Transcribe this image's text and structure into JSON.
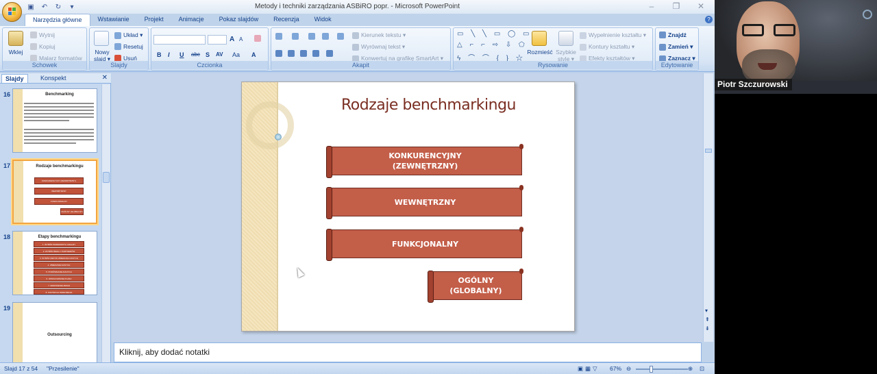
{
  "window": {
    "title": "Metody i techniki zarządzania ASBiRO popr. - Microsoft PowerPoint",
    "controls": [
      "–",
      "❐",
      "✕"
    ]
  },
  "tabs": [
    "Narzędzia główne",
    "Wstawianie",
    "Projekt",
    "Animacje",
    "Pokaz slajdów",
    "Recenzja",
    "Widok"
  ],
  "ribbon": {
    "clipboard": {
      "label": "Schowek",
      "paste": "Wklej",
      "cut": "Wytnij",
      "copy": "Kopiuj",
      "painter": "Malarz formatów"
    },
    "slides": {
      "label": "Slajdy",
      "new_slide_1": "Nowy",
      "new_slide_2": "slajd ▾",
      "layout": "Układ ▾",
      "reset": "Resetuj",
      "delete": "Usuń"
    },
    "font": {
      "label": "Czcionka",
      "bold": "B",
      "italic": "I",
      "underline": "U",
      "strike": "abc",
      "shadow": "S",
      "spacing": "AV",
      "case": "Aa",
      "color": "A",
      "grow": "A",
      "shrink": "A"
    },
    "paragraph": {
      "label": "Akapit",
      "text_direction": "Kierunek tekstu ▾",
      "align_text": "Wyrównaj tekst ▾",
      "smartart": "Konwertuj na grafikę SmartArt ▾"
    },
    "drawing": {
      "label": "Rysowanie",
      "arrange": "Rozmieść",
      "quick_styles_1": "Szybkie",
      "quick_styles_2": "style ▾",
      "fill": "Wypełnienie kształtu ▾",
      "outline": "Kontury kształtu ▾",
      "effects": "Efekty kształtów ▾"
    },
    "editing": {
      "label": "Edytowanie",
      "find": "Znajdź",
      "replace": "Zamień ▾",
      "select": "Zaznacz ▾"
    }
  },
  "left_pane": {
    "tabs": [
      "Slajdy",
      "Konspekt"
    ],
    "thumbnails": [
      {
        "number": "16",
        "title": "Benchmarking"
      },
      {
        "number": "17",
        "title": "Rodzaje benchmarkingu",
        "bars": [
          "KONKURENCYJNY (ZEWNĘTRZNY)",
          "WEWNĘTRZNY",
          "FUNKCJONALNY",
          "OGÓLNY (GLOBALNY)"
        ]
      },
      {
        "number": "18",
        "title": "Etapy benchmarkingu",
        "bars": [
          "1. WYBÓR PRZEDMIOTU ANALIZY",
          "2. WYBÓR BIEGU / PARTNERÓW",
          "3. WYBÓR METOD ZBIERANIA DANYCH",
          "4. ZBIERANIE DANYCH",
          "5. PORÓWNANIE DANYCH",
          "6. OPRACOWANIE PLANU",
          "7. WDROŻENIE ZMIAN",
          "8. KONTROLA WDROŻENIA"
        ]
      },
      {
        "number": "19",
        "title": "Outsourcing"
      }
    ]
  },
  "slide": {
    "title": "Rodzaje benchmarkingu",
    "banners": [
      {
        "line1": "KONKURENCYJNY",
        "line2": "(ZEWNĘTRZNY)"
      },
      {
        "line1": "WEWNĘTRZNY",
        "line2": ""
      },
      {
        "line1": "FUNKCJONALNY",
        "line2": ""
      },
      {
        "line1": "OGÓLNY",
        "line2": "(GLOBALNY)"
      }
    ]
  },
  "notes": {
    "placeholder": "Kliknij, aby dodać notatki"
  },
  "status": {
    "slide_position": "Slajd 17 z 54",
    "theme": "\"Przesilenie\"",
    "zoom": "67%"
  },
  "webcam": {
    "name": "Piotr Szczurowski"
  }
}
